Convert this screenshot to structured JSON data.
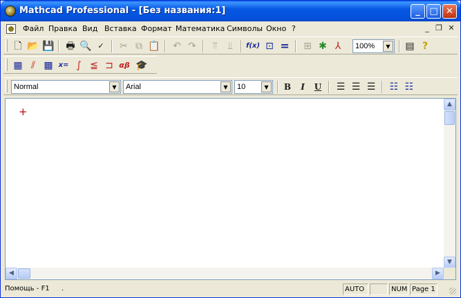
{
  "window": {
    "title": "Mathcad Professional - [Без названия:1]",
    "minimize": "_",
    "maximize": "□",
    "close": "✕"
  },
  "menu": {
    "items": [
      "Файл",
      "Правка",
      "Вид",
      "Вставка",
      "Формат",
      "Математика",
      "Символы",
      "Окно",
      "?"
    ],
    "mdi_minimize": "_",
    "mdi_restore": "❐",
    "mdi_close": "✕"
  },
  "toolbar_standard": {
    "zoom": "100%",
    "function_label": "f(x)",
    "equals_label": "="
  },
  "toolbar_math": {
    "eval_label": "x=",
    "greek_label": "αβ"
  },
  "toolbar_format": {
    "style": "Normal",
    "font": "Arial",
    "size": "10",
    "bold": "B",
    "italic": "I",
    "underline": "U"
  },
  "worksheet": {
    "cursor": "+"
  },
  "status": {
    "help": "Помощь - F1",
    "dot": ".",
    "auto": "AUTO",
    "empty": "",
    "num": "NUM",
    "page": "Page 1"
  },
  "colors": {
    "titlebar": "#0658e4",
    "cursor": "#c00000",
    "chrome": "#ece9d8"
  }
}
